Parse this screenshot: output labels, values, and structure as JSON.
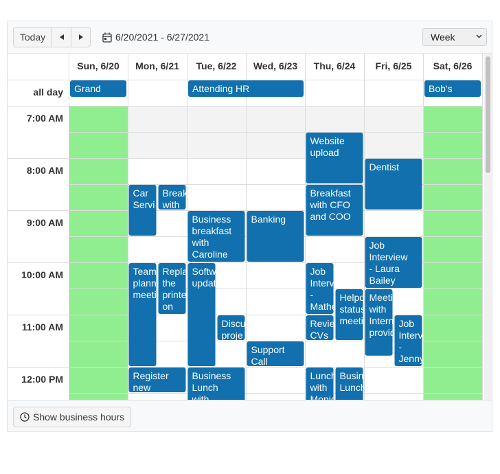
{
  "toolbar": {
    "today_label": "Today",
    "date_range": "6/20/2021 - 6/27/2021",
    "view_selected": "Week"
  },
  "footer": {
    "business_hours_label": "Show business hours"
  },
  "days": [
    "Sun, 6/20",
    "Mon, 6/21",
    "Tue, 6/22",
    "Wed, 6/23",
    "Thu, 6/24",
    "Fri, 6/25",
    "Sat, 6/26"
  ],
  "all_day_label": "all day",
  "time_labels": [
    "7:00 AM",
    "8:00 AM",
    "9:00 AM",
    "10:00 AM",
    "11:00 AM",
    "12:00 PM"
  ],
  "colors": {
    "event": "#1170ad",
    "nonwork": "#90ee90",
    "offhours": "#f3f3f3",
    "grid": "#dddddd"
  },
  "all_day_events": [
    {
      "text": "Grand",
      "day": 0,
      "span": 1
    },
    {
      "text": "Attending HR",
      "day": 2,
      "span": 2
    },
    {
      "text": "Bob's",
      "day": 6,
      "span": 1
    }
  ],
  "events": [
    {
      "lines": [
        "Website",
        "upload"
      ],
      "day": 4,
      "col": 0,
      "cols": 1,
      "start": 7.5,
      "end": 8.5
    },
    {
      "lines": [
        "Dentist"
      ],
      "day": 5,
      "col": 0,
      "cols": 1,
      "start": 8.0,
      "end": 9.0
    },
    {
      "lines": [
        "Car",
        "Servi"
      ],
      "day": 1,
      "col": 0,
      "cols": 2,
      "start": 8.5,
      "end": 9.5
    },
    {
      "lines": [
        "Break",
        "with"
      ],
      "day": 1,
      "col": 1,
      "cols": 2,
      "start": 8.5,
      "end": 9.0
    },
    {
      "lines": [
        "Breakfast",
        "with CFO",
        "and COO"
      ],
      "day": 4,
      "col": 0,
      "cols": 1,
      "start": 8.5,
      "end": 9.5
    },
    {
      "lines": [
        "Business",
        "breakfast",
        "with",
        "Caroline"
      ],
      "day": 2,
      "col": 0,
      "cols": 1,
      "start": 9.0,
      "end": 10.0
    },
    {
      "lines": [
        "Banking"
      ],
      "day": 3,
      "col": 0,
      "cols": 1,
      "start": 9.0,
      "end": 10.0
    },
    {
      "lines": [
        "Job",
        "Interview",
        "- Laura",
        "Bailey"
      ],
      "day": 5,
      "col": 0,
      "cols": 1,
      "start": 9.5,
      "end": 10.5
    },
    {
      "lines": [
        "Team",
        "plann",
        "meeti"
      ],
      "day": 1,
      "col": 0,
      "cols": 2,
      "start": 10.0,
      "end": 12.0
    },
    {
      "lines": [
        "Repla",
        "the",
        "printe",
        "on"
      ],
      "day": 1,
      "col": 1,
      "cols": 2,
      "start": 10.0,
      "end": 11.0
    },
    {
      "lines": [
        "Softw",
        "updat"
      ],
      "day": 2,
      "col": 0,
      "cols": 2,
      "start": 10.0,
      "end": 12.0
    },
    {
      "lines": [
        "Job",
        "Interv",
        "-",
        "Mathe"
      ],
      "day": 4,
      "col": 0,
      "cols": 2,
      "start": 10.0,
      "end": 11.0
    },
    {
      "lines": [
        "Helpd",
        "status",
        "meeti"
      ],
      "day": 4,
      "col": 1,
      "cols": 2,
      "start": 10.5,
      "end": 11.5
    },
    {
      "lines": [
        "Meeti",
        "with",
        "Intern",
        "provid"
      ],
      "day": 5,
      "col": 0,
      "cols": 2,
      "start": 10.5,
      "end": 11.8
    },
    {
      "lines": [
        "Discu",
        "proje"
      ],
      "day": 2,
      "col": 1,
      "cols": 2,
      "start": 11.0,
      "end": 11.5
    },
    {
      "lines": [
        "Revie",
        "CVs"
      ],
      "day": 4,
      "col": 0,
      "cols": 2,
      "start": 11.0,
      "end": 11.5
    },
    {
      "lines": [
        "Job",
        "Interv",
        "-",
        "Jenny"
      ],
      "day": 5,
      "col": 1,
      "cols": 2,
      "start": 11.0,
      "end": 12.0
    },
    {
      "lines": [
        "Support",
        "Call"
      ],
      "day": 3,
      "col": 0,
      "cols": 1,
      "start": 11.5,
      "end": 12.0
    },
    {
      "lines": [
        "Register",
        "new"
      ],
      "day": 1,
      "col": 0,
      "cols": 1,
      "start": 12.0,
      "end": 12.5
    },
    {
      "lines": [
        "Business",
        "Lunch",
        "with"
      ],
      "day": 2,
      "col": 0,
      "cols": 1,
      "start": 12.0,
      "end": 13.0
    },
    {
      "lines": [
        "Lunch",
        "with",
        "Monic"
      ],
      "day": 4,
      "col": 0,
      "cols": 2,
      "start": 12.0,
      "end": 13.0
    },
    {
      "lines": [
        "Busin",
        "Lunch"
      ],
      "day": 4,
      "col": 1,
      "cols": 2,
      "start": 12.0,
      "end": 13.0
    }
  ]
}
